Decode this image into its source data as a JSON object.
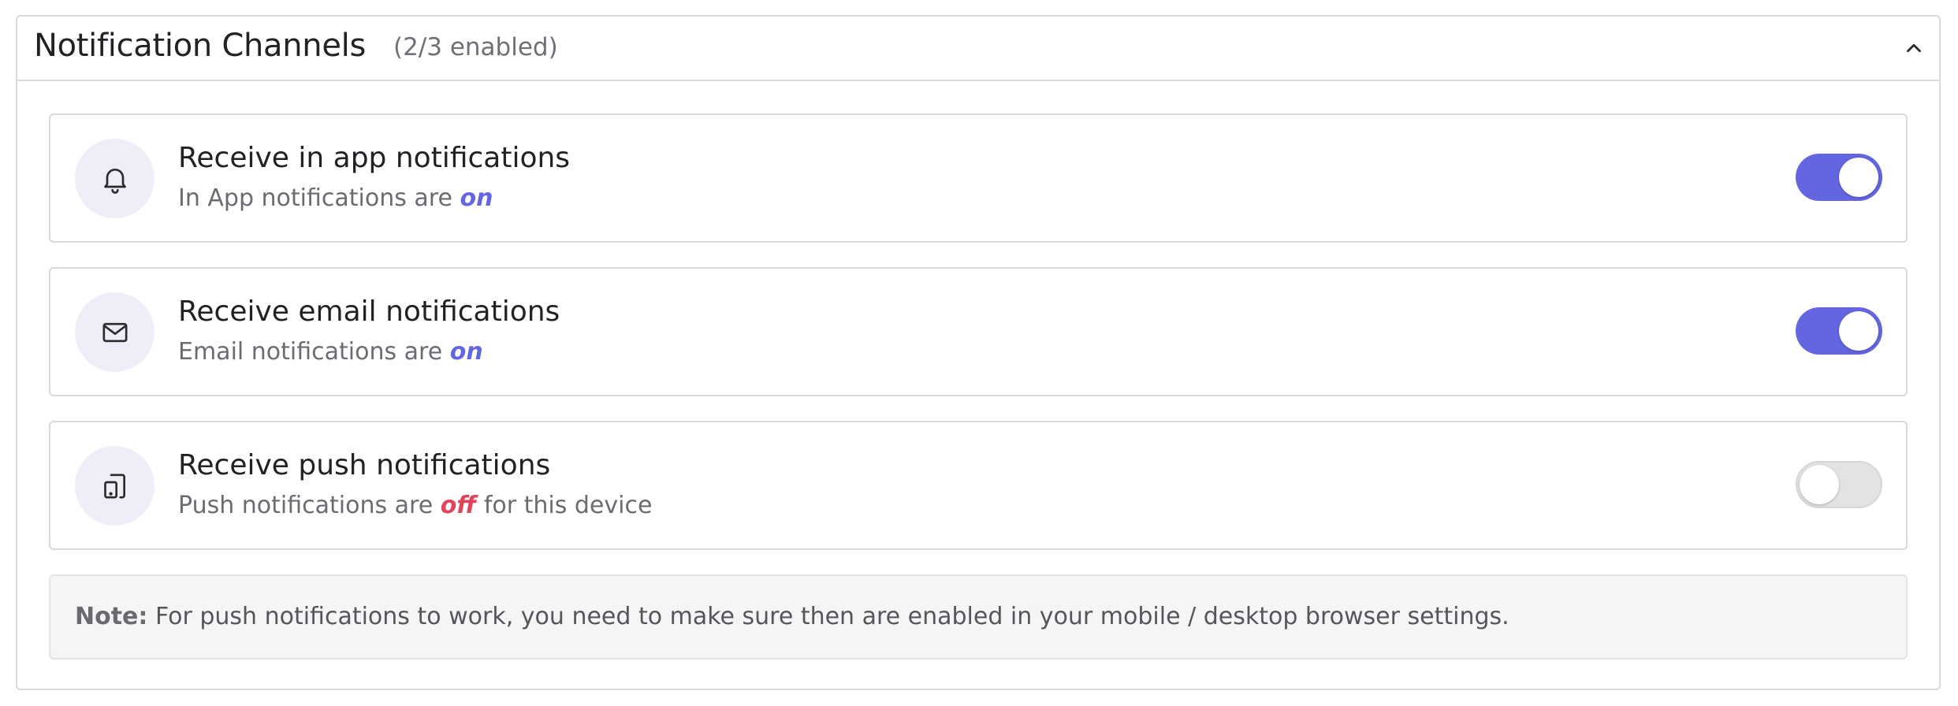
{
  "panel": {
    "title": "Notification Channels",
    "count": "(2/3 enabled)",
    "collapse_icon": "chevron-up-icon"
  },
  "channels": [
    {
      "icon": "bell-icon",
      "title": "Receive in app notifications",
      "desc_prefix": "In App notifications are ",
      "state": "on",
      "desc_suffix": "",
      "enabled": true
    },
    {
      "icon": "mail-icon",
      "title": "Receive email notifications",
      "desc_prefix": "Email notifications are ",
      "state": "on",
      "desc_suffix": "",
      "enabled": true
    },
    {
      "icon": "device-icon",
      "title": "Receive push notifications",
      "desc_prefix": "Push notifications are ",
      "state": "off",
      "desc_suffix": " for this device",
      "enabled": false
    }
  ],
  "note": {
    "label": "Note:",
    "text": " For push notifications to work, you need to make sure then are enabled in your mobile / desktop browser settings."
  },
  "colors": {
    "accent": "#6366e0",
    "off_state": "#e0445a",
    "icon_bg": "#eeeef8"
  }
}
